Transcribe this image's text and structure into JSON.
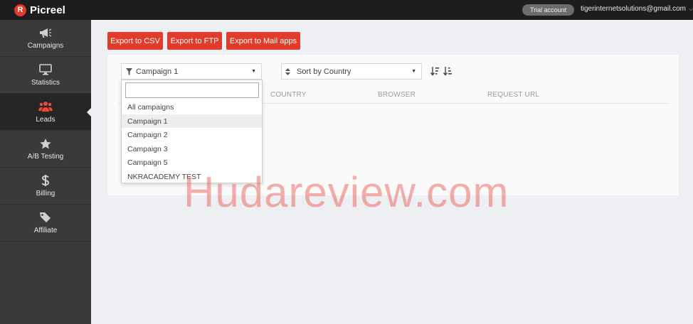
{
  "app": {
    "logo_letter": "R",
    "name": "Picreel"
  },
  "topbar": {
    "trial_label": "Trial account",
    "account_email": "tigerinternetsolutions@gmail.com",
    "account_chevron": "⌵"
  },
  "sidebar": {
    "items": [
      {
        "label": "Campaigns",
        "icon": "megaphone-icon"
      },
      {
        "label": "Statistics",
        "icon": "monitor-icon"
      },
      {
        "label": "Leads",
        "icon": "users-icon",
        "active": true
      },
      {
        "label": "A/B Testing",
        "icon": "star-icon"
      },
      {
        "label": "Billing",
        "icon": "dollar-icon"
      },
      {
        "label": "Affiliate",
        "icon": "tag-icon"
      }
    ]
  },
  "toolbar": {
    "export_csv": "Export to CSV",
    "export_ftp": "Export to FTP",
    "export_mail": "Export to Mail apps"
  },
  "filters": {
    "campaign_selected": "Campaign 1",
    "sort_selected": "Sort by Country",
    "caret": "▼"
  },
  "table": {
    "columns": [
      "COUNTRY",
      "BROWSER",
      "REQUEST URL"
    ]
  },
  "dropdown": {
    "search_value": "",
    "options": [
      "All campaigns",
      "Campaign 1",
      "Campaign 2",
      "Campaign 3",
      "Campaign 5",
      "NKRACADEMY TEST"
    ],
    "selected_index": 1
  },
  "watermark": "Hudareview.com",
  "colors": {
    "accent": "#e13b2c",
    "sidebar": "#3a3a3a",
    "topbar": "#1d1d1d"
  }
}
